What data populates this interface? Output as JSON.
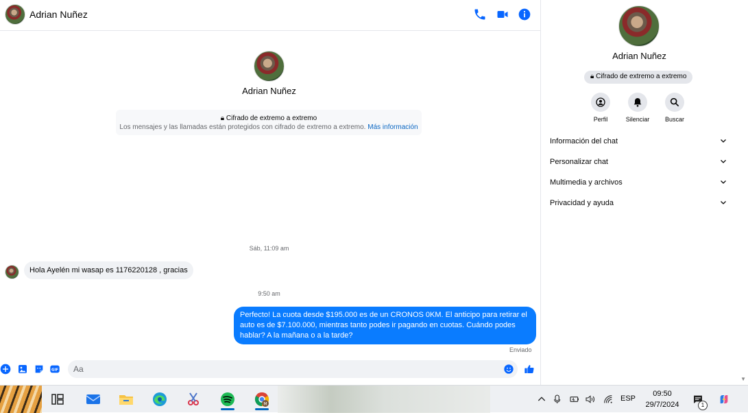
{
  "contact": {
    "name": "Adrian Nuñez"
  },
  "header": {
    "call_icon": "phone-icon",
    "video_icon": "video-camera-icon",
    "info_icon": "info-icon"
  },
  "intro": {
    "name": "Adrian Nuñez",
    "e2e_title": "Cifrado de extremo a extremo",
    "e2e_text": "Los mensajes y las llamadas están protegidos con cifrado de extremo a extremo.",
    "e2e_link": "Más información"
  },
  "messages": {
    "time1": "Sáb, 11:09 am",
    "incoming": "Hola Ayelén mi wasap es 1176220128 , gracias",
    "time2": "9:50 am",
    "outgoing": "Perfecto! La cuota desde $195.000 es de un CRONOS 0KM. El anticipo para retirar el auto es de $7.100.000, mientras tanto podes ir pagando en cuotas. Cuándo podes hablar? A la mañana o a la tarde?",
    "sent_status": "Enviado"
  },
  "composer": {
    "placeholder": "Aa"
  },
  "panel": {
    "name": "Adrian Nuñez",
    "e2e": "Cifrado de extremo a extremo",
    "actions": [
      {
        "label": "Perfil",
        "icon": "profile-icon"
      },
      {
        "label": "Silenciar",
        "icon": "bell-icon"
      },
      {
        "label": "Buscar",
        "icon": "search-icon"
      }
    ],
    "sections": [
      "Información del chat",
      "Personalizar chat",
      "Multimedia y archivos",
      "Privacidad y ayuda"
    ]
  },
  "taskbar": {
    "language": "ESP",
    "time": "09:50",
    "date": "29/7/2024",
    "notification_count": "1"
  },
  "colors": {
    "accent": "#0a7cff",
    "link": "#0a66c2",
    "icon_blue": "#0866ff"
  }
}
